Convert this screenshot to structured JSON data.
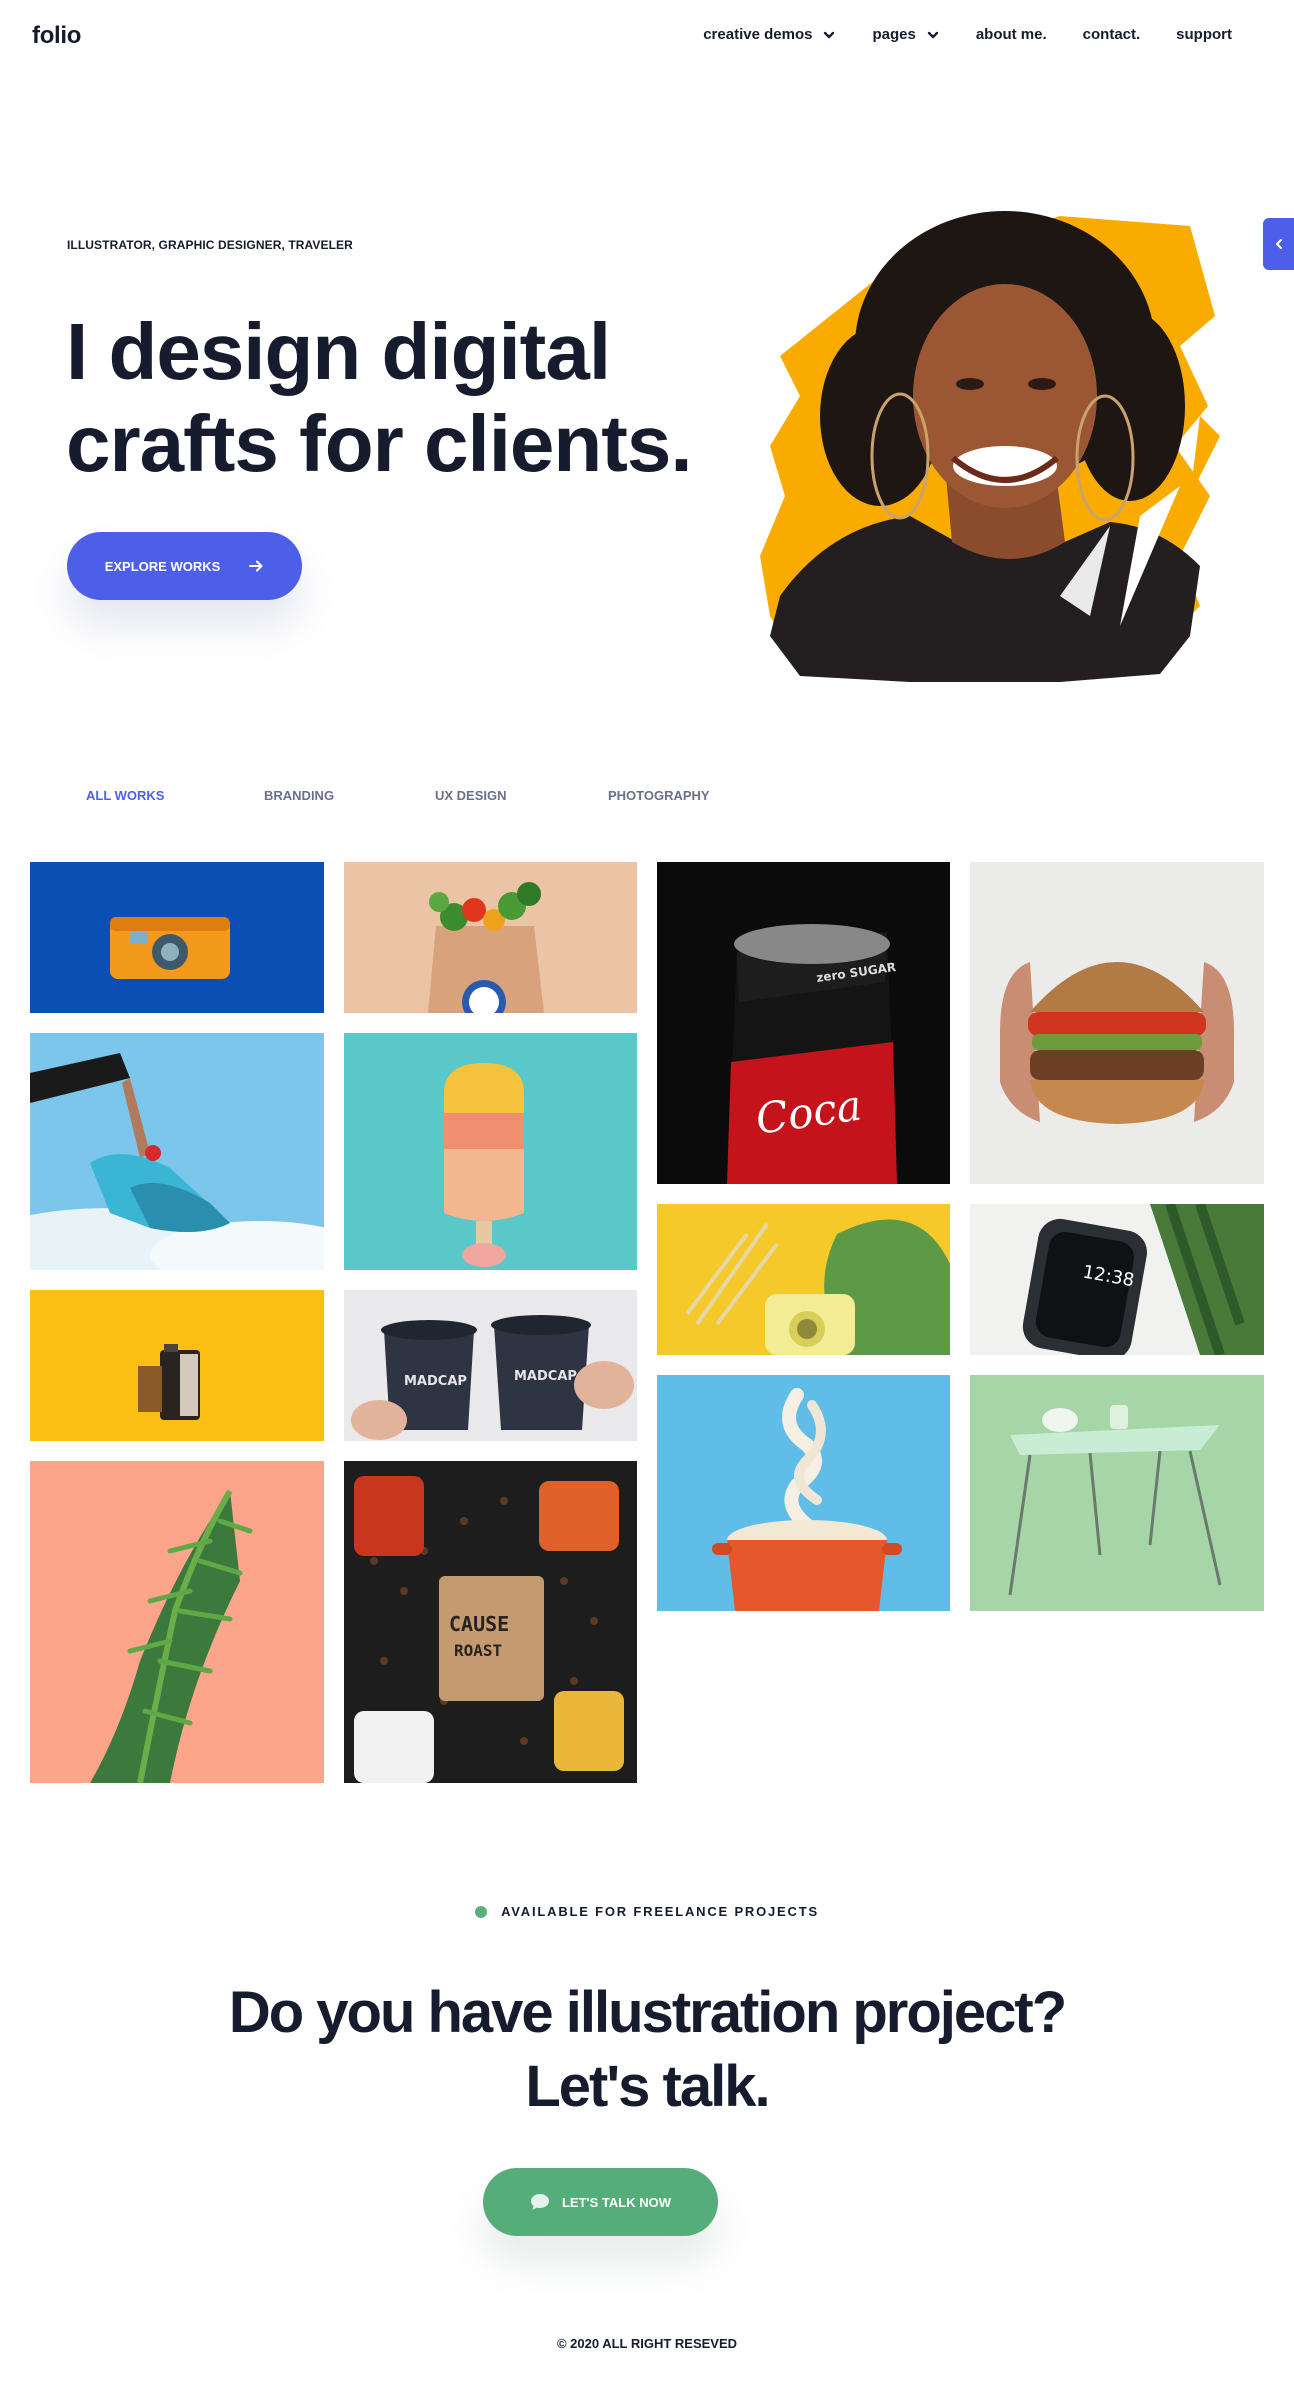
{
  "header": {
    "logo": "folio",
    "nav": [
      {
        "label": "creative demos",
        "has_dropdown": true
      },
      {
        "label": "pages",
        "has_dropdown": true
      },
      {
        "label": "about me.",
        "has_dropdown": false
      },
      {
        "label": "contact.",
        "has_dropdown": false
      },
      {
        "label": "support",
        "has_dropdown": false
      }
    ]
  },
  "side_tab": {
    "icon": "chevron-left-icon"
  },
  "hero": {
    "eyebrow": "ILLUSTRATOR, GRAPHIC DESIGNER, TRAVELER",
    "title": "I design digital crafts for clients.",
    "button_label": "EXPLORE WORKS",
    "button_icon": "arrow-right-icon",
    "portrait_icon": "portrait-photo"
  },
  "filters": {
    "items": [
      "ALL WORKS",
      "BRANDING",
      "UX DESIGN",
      "PHOTOGRAPHY"
    ],
    "active": "ALL WORKS"
  },
  "gallery": {
    "items": [
      {
        "name": "orange-camera-photo"
      },
      {
        "name": "grocery-bag-photo"
      },
      {
        "name": "cola-can-photo"
      },
      {
        "name": "burger-photo"
      },
      {
        "name": "sneakers-photo"
      },
      {
        "name": "popsicle-photo"
      },
      {
        "name": "instant-camera-photo"
      },
      {
        "name": "smartwatch-photo"
      },
      {
        "name": "film-roll-photo"
      },
      {
        "name": "coffee-cups-photo"
      },
      {
        "name": "noodles-pot-photo"
      },
      {
        "name": "green-table-photo"
      },
      {
        "name": "plant-photo"
      },
      {
        "name": "coffee-bag-photo"
      }
    ]
  },
  "cta": {
    "availability": "AVAILABLE FOR FREELANCE PROJECTS",
    "title": "Do you have illustration project? Let's talk.",
    "button_label": "LET'S TALK NOW",
    "button_icon": "chat-bubble-icon"
  },
  "footer": {
    "copyright": "© 2020 ALL RIGHT RESEVED"
  },
  "colors": {
    "primary": "#4d5fe9",
    "success": "#55ad7a",
    "dark": "#161c2d",
    "muted": "#6b7088"
  }
}
